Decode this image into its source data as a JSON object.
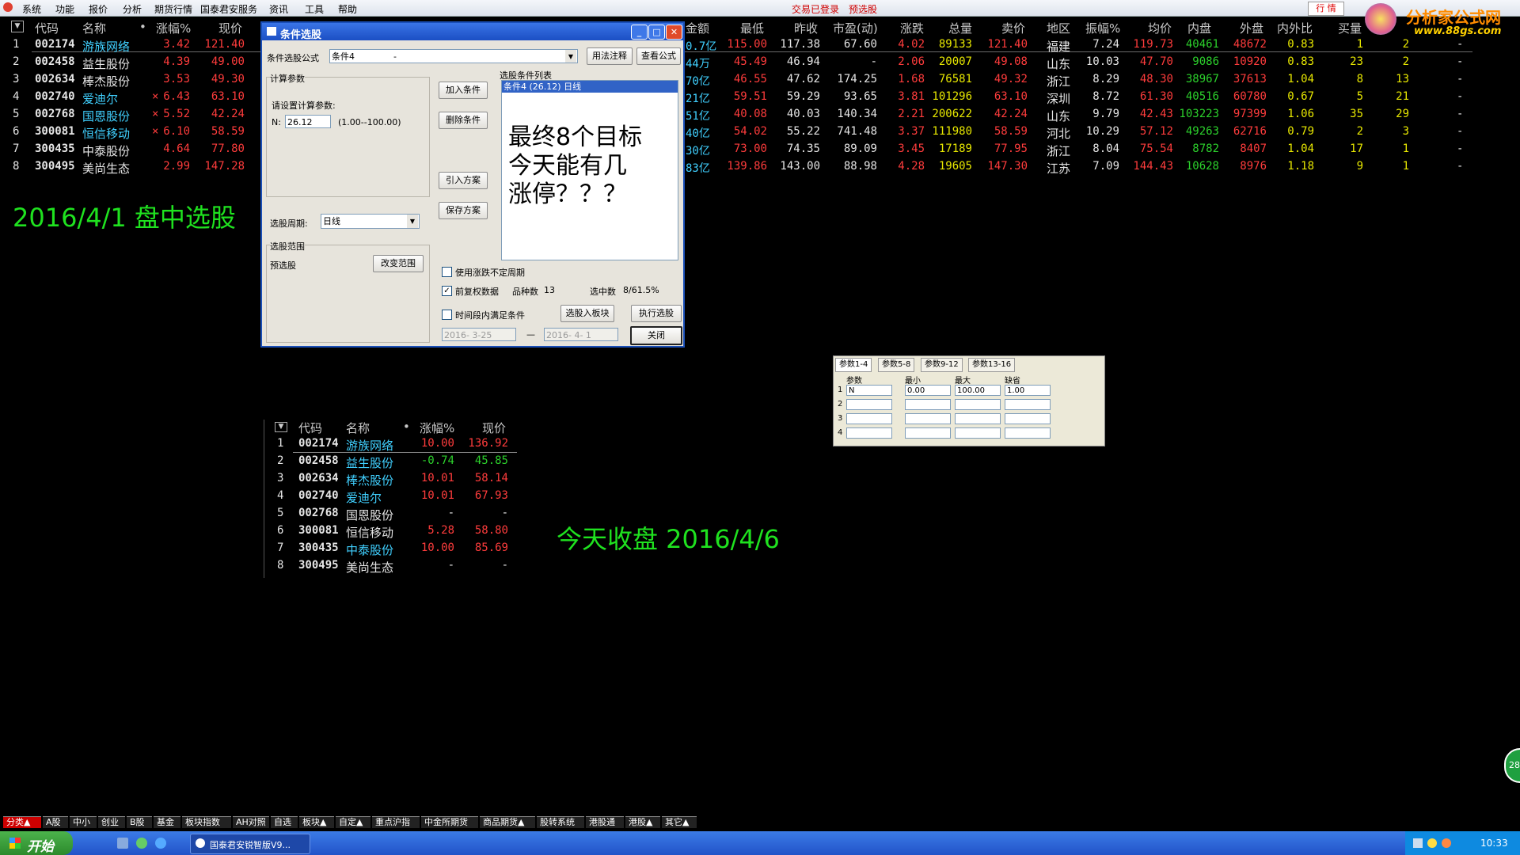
{
  "menubar": {
    "items": [
      "系统",
      "功能",
      "报价",
      "分析",
      "期货行情",
      "国泰君安服务",
      "资讯",
      "工具",
      "帮助"
    ],
    "status_login": "交易已登录",
    "status_warn": "预选股",
    "quote_btn": "行 情"
  },
  "logo": {
    "text": "分析家公式网",
    "url": "www.88gs.com"
  },
  "main_table": {
    "headers": [
      "代码",
      "名称",
      "•",
      "涨幅%",
      "现价",
      "金额",
      "最低",
      "昨收",
      "市盈(动)",
      "涨跌",
      "总量",
      "卖价",
      "地区",
      "振幅%",
      "均价",
      "内盘",
      "外盘",
      "内外比",
      "买量"
    ],
    "rows": [
      {
        "n": "1",
        "code": "002174",
        "name": "游族网络",
        "flag": "",
        "chg": "3.42",
        "price": "121.40",
        "amt": "0.7亿",
        "low": "115.00",
        "prev": "117.38",
        "pe": "67.60",
        "diff": "4.02",
        "vol": "89133",
        "ask": "121.40",
        "region": "福建",
        "amp": "7.24",
        "avg": "119.73",
        "inner": "40461",
        "outer": "48672",
        "ratio": "0.83",
        "bq": "1",
        "x": "2"
      },
      {
        "n": "2",
        "code": "002458",
        "name": "益生股份",
        "flag": "",
        "chg": "4.39",
        "price": "49.00",
        "amt": "44万",
        "low": "45.49",
        "prev": "46.94",
        "pe": "-",
        "diff": "2.06",
        "vol": "20007",
        "ask": "49.08",
        "region": "山东",
        "amp": "10.03",
        "avg": "47.70",
        "inner": "9086",
        "outer": "10920",
        "ratio": "0.83",
        "bq": "23",
        "x": "2"
      },
      {
        "n": "3",
        "code": "002634",
        "name": "棒杰股份",
        "flag": "",
        "chg": "3.53",
        "price": "49.30",
        "amt": "70亿",
        "low": "46.55",
        "prev": "47.62",
        "pe": "174.25",
        "diff": "1.68",
        "vol": "76581",
        "ask": "49.32",
        "region": "浙江",
        "amp": "8.29",
        "avg": "48.30",
        "inner": "38967",
        "outer": "37613",
        "ratio": "1.04",
        "bq": "8",
        "x": "13"
      },
      {
        "n": "4",
        "code": "002740",
        "name": "爱迪尔",
        "flag": "×",
        "chg": "6.43",
        "price": "63.10",
        "amt": "21亿",
        "low": "59.51",
        "prev": "59.29",
        "pe": "93.65",
        "diff": "3.81",
        "vol": "101296",
        "ask": "63.10",
        "region": "深圳",
        "amp": "8.72",
        "avg": "61.30",
        "inner": "40516",
        "outer": "60780",
        "ratio": "0.67",
        "bq": "5",
        "x": "21"
      },
      {
        "n": "5",
        "code": "002768",
        "name": "国恩股份",
        "flag": "×",
        "chg": "5.52",
        "price": "42.24",
        "amt": "51亿",
        "low": "40.08",
        "prev": "40.03",
        "pe": "140.34",
        "diff": "2.21",
        "vol": "200622",
        "ask": "42.24",
        "region": "山东",
        "amp": "9.79",
        "avg": "42.43",
        "inner": "103223",
        "outer": "97399",
        "ratio": "1.06",
        "bq": "35",
        "x": "29"
      },
      {
        "n": "6",
        "code": "300081",
        "name": "恒信移动",
        "flag": "×",
        "chg": "6.10",
        "price": "58.59",
        "amt": "40亿",
        "low": "54.02",
        "prev": "55.22",
        "pe": "741.48",
        "diff": "3.37",
        "vol": "111980",
        "ask": "58.59",
        "region": "河北",
        "amp": "10.29",
        "avg": "57.12",
        "inner": "49263",
        "outer": "62716",
        "ratio": "0.79",
        "bq": "2",
        "x": "3"
      },
      {
        "n": "7",
        "code": "300435",
        "name": "中泰股份",
        "flag": "",
        "chg": "4.64",
        "price": "77.80",
        "amt": "30亿",
        "low": "73.00",
        "prev": "74.35",
        "pe": "89.09",
        "diff": "3.45",
        "vol": "17189",
        "ask": "77.95",
        "region": "浙江",
        "amp": "8.04",
        "avg": "75.54",
        "inner": "8782",
        "outer": "8407",
        "ratio": "1.04",
        "bq": "17",
        "x": "1"
      },
      {
        "n": "8",
        "code": "300495",
        "name": "美尚生态",
        "flag": "",
        "chg": "2.99",
        "price": "147.28",
        "amt": "83亿",
        "low": "139.86",
        "prev": "143.00",
        "pe": "88.98",
        "diff": "4.28",
        "vol": "19605",
        "ask": "147.30",
        "region": "江苏",
        "amp": "7.09",
        "avg": "144.43",
        "inner": "10628",
        "outer": "8976",
        "ratio": "1.18",
        "bq": "9",
        "x": "1"
      }
    ],
    "dash": "-"
  },
  "caption1": "2016/4/1  盘中选股",
  "caption2": "今天收盘     2016/4/6",
  "dialog": {
    "title": "条件选股",
    "formula_label": "条件选股公式",
    "formula_value": "条件4",
    "formula_dash": "-",
    "usage_btn": "用法注释",
    "view_btn": "查看公式",
    "calc_group": "计算参数",
    "calc_hint": "请设置计算参数:",
    "param_n": "N:",
    "param_val": "26.12",
    "param_range": "(1.00--100.00)",
    "add_btn": "加入条件",
    "del_btn": "删除条件",
    "import_btn": "引入方案",
    "save_btn": "保存方案",
    "list_title": "选股条件列表",
    "list_item": "条件4 (26.12) 日线",
    "overlay_text": "最终8个目标\n今天能有几\n涨停？？？",
    "period_label": "选股周期:",
    "period_value": "日线",
    "scope_group": "选股范围",
    "scope_value": "预选股",
    "change_scope_btn": "改变范围",
    "chk1": "使用涨跌不定周期",
    "chk2": "前复权数据",
    "chk2_checked": "✓",
    "count_label": "品种数",
    "count_value": "13",
    "selected_label": "选中数",
    "selected_value": "8/61.5%",
    "chk3": "时间段内满足条件",
    "to_block_btn": "选股入板块",
    "exec_btn": "执行选股",
    "date_from": "2016- 3-25",
    "date_sep": "—",
    "date_to": "2016- 4- 1",
    "close_btn": "关闭"
  },
  "param_panel": {
    "tabs": [
      "参数1-4",
      "参数5-8",
      "参数9-12",
      "参数13-16"
    ],
    "cols": [
      "参数",
      "最小",
      "最大",
      "缺省"
    ],
    "rows": [
      {
        "i": "1",
        "name": "N",
        "min": "0.00",
        "max": "100.00",
        "def": "1.00"
      },
      {
        "i": "2",
        "name": "",
        "min": "",
        "max": "",
        "def": ""
      },
      {
        "i": "3",
        "name": "",
        "min": "",
        "max": "",
        "def": ""
      },
      {
        "i": "4",
        "name": "",
        "min": "",
        "max": "",
        "def": ""
      }
    ]
  },
  "small_table": {
    "headers": [
      "代码",
      "名称",
      "•",
      "涨幅%",
      "现价"
    ],
    "rows": [
      {
        "n": "1",
        "code": "002174",
        "name": "游族网络",
        "chg": "10.00",
        "price": "136.92",
        "c": "rd"
      },
      {
        "n": "2",
        "code": "002458",
        "name": "益生股份",
        "chg": "-0.74",
        "price": "45.85",
        "c": "gr"
      },
      {
        "n": "3",
        "code": "002634",
        "name": "棒杰股份",
        "chg": "10.01",
        "price": "58.14",
        "c": "rd"
      },
      {
        "n": "4",
        "code": "002740",
        "name": "爱迪尔",
        "chg": "10.01",
        "price": "67.93",
        "c": "rd"
      },
      {
        "n": "5",
        "code": "002768",
        "name": "国恩股份",
        "chg": "-",
        "price": "-",
        "c": "wt"
      },
      {
        "n": "6",
        "code": "300081",
        "name": "恒信移动",
        "chg": "5.28",
        "price": "58.80",
        "c": "rd"
      },
      {
        "n": "7",
        "code": "300435",
        "name": "中泰股份",
        "chg": "10.00",
        "price": "85.69",
        "c": "rd"
      },
      {
        "n": "8",
        "code": "300495",
        "name": "美尚生态",
        "chg": "-",
        "price": "-",
        "c": "wt"
      }
    ]
  },
  "bottom_tabs": [
    "分类▲",
    "A股",
    "中小",
    "创业",
    "B股",
    "基金",
    "板块指数",
    "AH对照",
    "自选",
    "板块▲",
    "自定▲",
    "重点沪指",
    "中金所期货",
    "商品期货▲",
    "股转系统",
    "港股通",
    "港股▲",
    "其它▲"
  ],
  "taskbar": {
    "start": "开始",
    "task": "国泰君安锐智版V9...",
    "clock": "10:33"
  },
  "side_badge": "28"
}
